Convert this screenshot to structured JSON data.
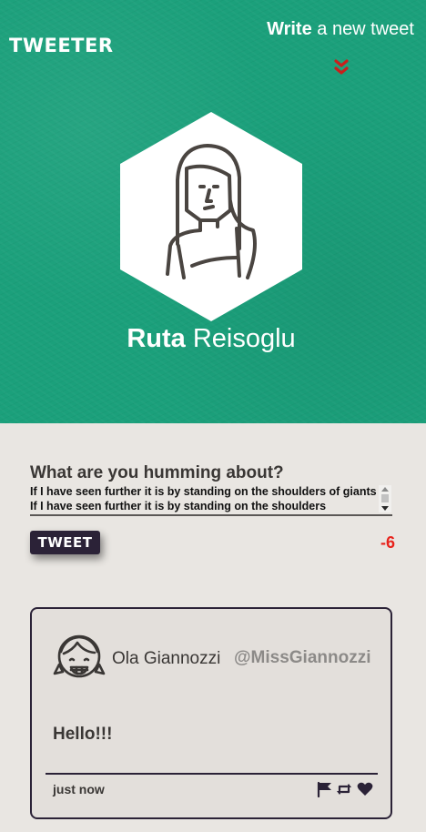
{
  "header": {
    "logo": "TWEETER",
    "write_link": {
      "strong": "Write",
      "rest": " a new tweet"
    },
    "expand_icon": "double-chevron-down-icon"
  },
  "profile": {
    "first_name": "Ruta",
    "last_name": "Reisoglu",
    "avatar_icon": "woman-avatar-icon"
  },
  "compose": {
    "label": "What are you humming about?",
    "text": "If I have seen further it is by standing on the shoulders of giants If I have seen further it is by standing on the shoulders",
    "button_label": "TWEET",
    "char_count": "-6"
  },
  "tweets": [
    {
      "name": "Ola Giannozzi",
      "handle": "@MissGiannozzi",
      "message": "Hello!!!",
      "time": "just now",
      "avatar_icon": "girl-avatar-icon",
      "actions": [
        "flag-icon",
        "retweet-icon",
        "heart-icon"
      ]
    }
  ],
  "colors": {
    "header_bg": "#1ba07b",
    "page_bg": "#e9e6e2",
    "dark_accent": "#2b2237",
    "chevron": "#c8201c",
    "count_negative": "#e8231c"
  }
}
